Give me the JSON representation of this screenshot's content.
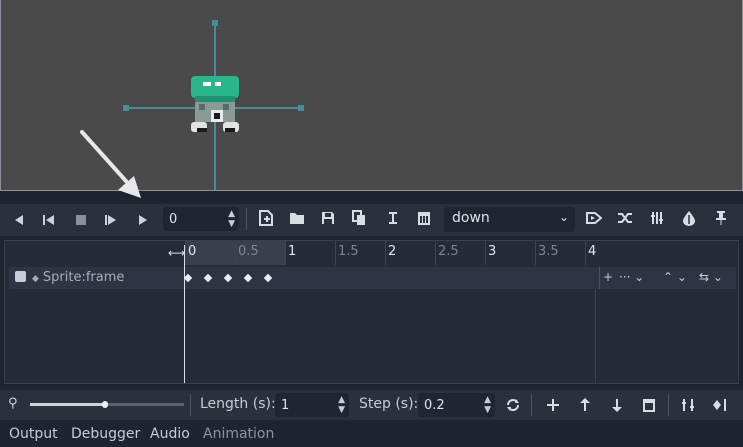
{
  "player": {
    "frame_value": "0",
    "animation_selected": "down"
  },
  "timeline": {
    "ruler_labels": [
      "0",
      "0.5",
      "1",
      "1.5",
      "2",
      "2.5",
      "3",
      "3.5",
      "4"
    ],
    "track_name": "Sprite:frame",
    "keyframe_count": 5
  },
  "bottom_bar": {
    "length_label": "Length (s):",
    "length_value": "1",
    "step_label": "Step (s):",
    "step_value": "0.2",
    "zoom_level": 0.49
  },
  "tabs": {
    "output": "Output",
    "debugger": "Debugger",
    "audio": "Audio",
    "animation": "Animation"
  },
  "colors": {
    "gizmo": "#4a8c96",
    "sprite_hat": "#2bb58a",
    "panel_bg": "#2b303d",
    "viewport_bg": "#4a4a4a"
  }
}
